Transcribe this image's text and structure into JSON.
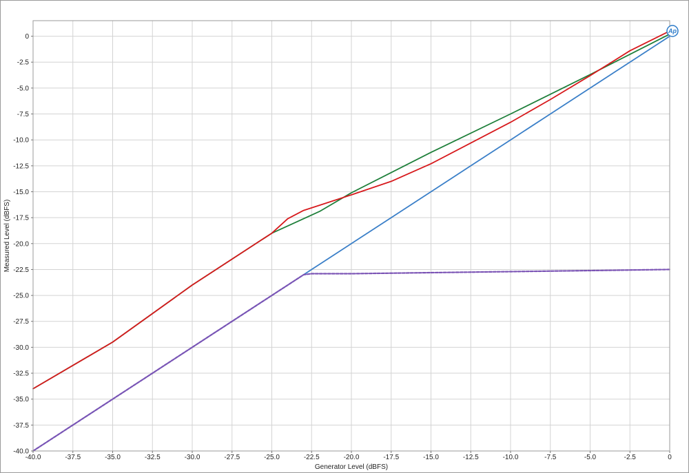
{
  "chart_data": {
    "type": "line",
    "title": "",
    "xlabel": "Generator Level (dBFS)",
    "ylabel": "Measured Level (dBFS)",
    "xlim": [
      -40,
      0
    ],
    "ylim": [
      -40,
      1.5
    ],
    "x_ticks": [
      -40.0,
      -37.5,
      -35.0,
      -32.5,
      -30.0,
      -27.5,
      -25.0,
      -22.5,
      -20.0,
      -17.5,
      -15.0,
      -12.5,
      -10.0,
      -7.5,
      -5.0,
      -2.5,
      0
    ],
    "x_tick_labels": [
      "-40.0",
      "-37.5",
      "-35.0",
      "-32.5",
      "-30.0",
      "-27.5",
      "-25.0",
      "-22.5",
      "-20.0",
      "-17.5",
      "-15.0",
      "-12.5",
      "-10.0",
      "-7.5",
      "-5.0",
      "-2.5",
      "0"
    ],
    "y_ticks": [
      0,
      -2.5,
      -5.0,
      -7.5,
      -10.0,
      -12.5,
      -15.0,
      -17.5,
      -20.0,
      -22.5,
      -25.0,
      -27.5,
      -30.0,
      -32.5,
      -35.0,
      -37.5,
      -40.0
    ],
    "y_tick_labels": [
      "0",
      "-2.5",
      "-5.0",
      "-7.5",
      "-10.0",
      "-12.5",
      "-15.0",
      "-17.5",
      "-20.0",
      "-22.5",
      "-25.0",
      "-27.5",
      "-30.0",
      "-32.5",
      "-35.0",
      "-37.5",
      "-40.0"
    ],
    "grid": true,
    "legend": "none",
    "logo_text": "Ap",
    "series": [
      {
        "color": "#1e7f3a",
        "style": "solid",
        "points": [
          [
            -40,
            -34.0
          ],
          [
            -35,
            -29.5
          ],
          [
            -30,
            -24.0
          ],
          [
            -25,
            -19.0
          ],
          [
            -24,
            -18.3
          ],
          [
            -22,
            -16.9
          ],
          [
            -20,
            -15.1
          ],
          [
            -15,
            -11.2
          ],
          [
            -10,
            -7.5
          ],
          [
            -5,
            -3.7
          ],
          [
            0,
            0.2
          ]
        ]
      },
      {
        "color": "#d7191c",
        "style": "solid",
        "points": [
          [
            -40,
            -34.0
          ],
          [
            -35,
            -29.5
          ],
          [
            -30,
            -24.0
          ],
          [
            -25,
            -19.0
          ],
          [
            -24,
            -17.6
          ],
          [
            -23,
            -16.8
          ],
          [
            -22,
            -16.3
          ],
          [
            -20,
            -15.3
          ],
          [
            -17.5,
            -14.0
          ],
          [
            -15,
            -12.3
          ],
          [
            -12.5,
            -10.3
          ],
          [
            -10,
            -8.3
          ],
          [
            -7.5,
            -6.1
          ],
          [
            -5,
            -3.8
          ],
          [
            -2.5,
            -1.4
          ],
          [
            0,
            0.5
          ]
        ]
      },
      {
        "color": "#3a7fc8",
        "style": "solid",
        "points": [
          [
            -40,
            -40.0
          ],
          [
            -35,
            -35.0
          ],
          [
            -30,
            -30.0
          ],
          [
            -25,
            -25.0
          ],
          [
            -23,
            -23.0
          ],
          [
            -22.5,
            -22.5
          ],
          [
            -20,
            -20.0
          ],
          [
            -17.5,
            -17.5
          ],
          [
            -15,
            -15.0
          ],
          [
            -12.5,
            -12.5
          ],
          [
            -10,
            -10.0
          ],
          [
            -7.5,
            -7.5
          ],
          [
            -5,
            -5.0
          ],
          [
            -2.5,
            -2.5
          ],
          [
            0,
            0.0
          ]
        ]
      },
      {
        "color": "#7b54b5",
        "style": "dashed",
        "points": [
          [
            -40,
            -40.0
          ],
          [
            -35,
            -35.0
          ],
          [
            -30,
            -30.0
          ],
          [
            -25,
            -25.0
          ],
          [
            -23,
            -23.0
          ],
          [
            -22.5,
            -22.9
          ],
          [
            -20,
            -22.9
          ],
          [
            -15,
            -22.8
          ],
          [
            -10,
            -22.7
          ],
          [
            -5,
            -22.6
          ],
          [
            0,
            -22.5
          ]
        ]
      }
    ]
  }
}
